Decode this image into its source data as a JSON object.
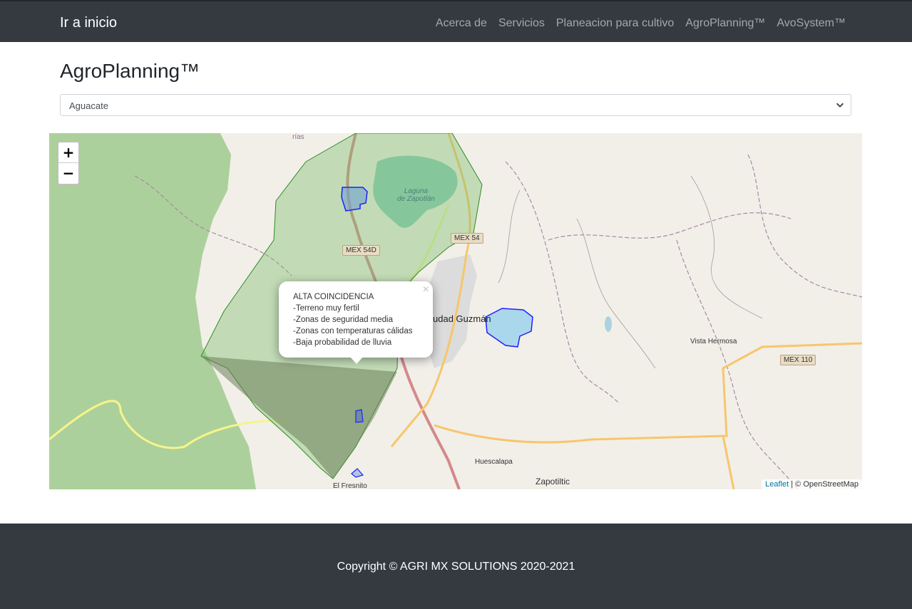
{
  "navbar": {
    "brand": "Ir a inicio",
    "links": [
      "Acerca de",
      "Servicios",
      "Planeacion para cultivo",
      "AgroPlanning™",
      "AvoSystem™"
    ]
  },
  "page": {
    "title": "AgroPlanning™",
    "crop_select": {
      "selected": "Aguacate"
    }
  },
  "map": {
    "zoom_in": "+",
    "zoom_out": "−",
    "popup": {
      "close": "×",
      "lines": [
        "ALTA COINCIDENCIA",
        "-Terreno muy fertil",
        "-Zonas de seguridad media",
        "-Zonas con temperaturas cálidas",
        "-Baja probabilidad de lluvia"
      ]
    },
    "labels": {
      "lake": "Laguna\nde Zapotlán",
      "city": "udad Guzmán",
      "vista": "Vista Hermosa",
      "huescalapa": "Huescalapa",
      "zapotiltic": "Zapotiltic",
      "fresnito": "El Fresnito",
      "rias": "rías"
    },
    "shields": {
      "mex54d": "MEX 54D",
      "mex54": "MEX 54",
      "mex110": "MEX 110"
    },
    "attribution": {
      "leaflet": "Leaflet",
      "rest": " | © OpenStreetMap"
    },
    "colors": {
      "zone_fill": "#7bbf6a",
      "zone_stroke": "#2e8b22",
      "parcel_stroke": "#2020ff",
      "forest": "#acd09b"
    }
  },
  "footer": {
    "copyright": "Copyright © AGRI MX SOLUTIONS 2020-2021"
  }
}
